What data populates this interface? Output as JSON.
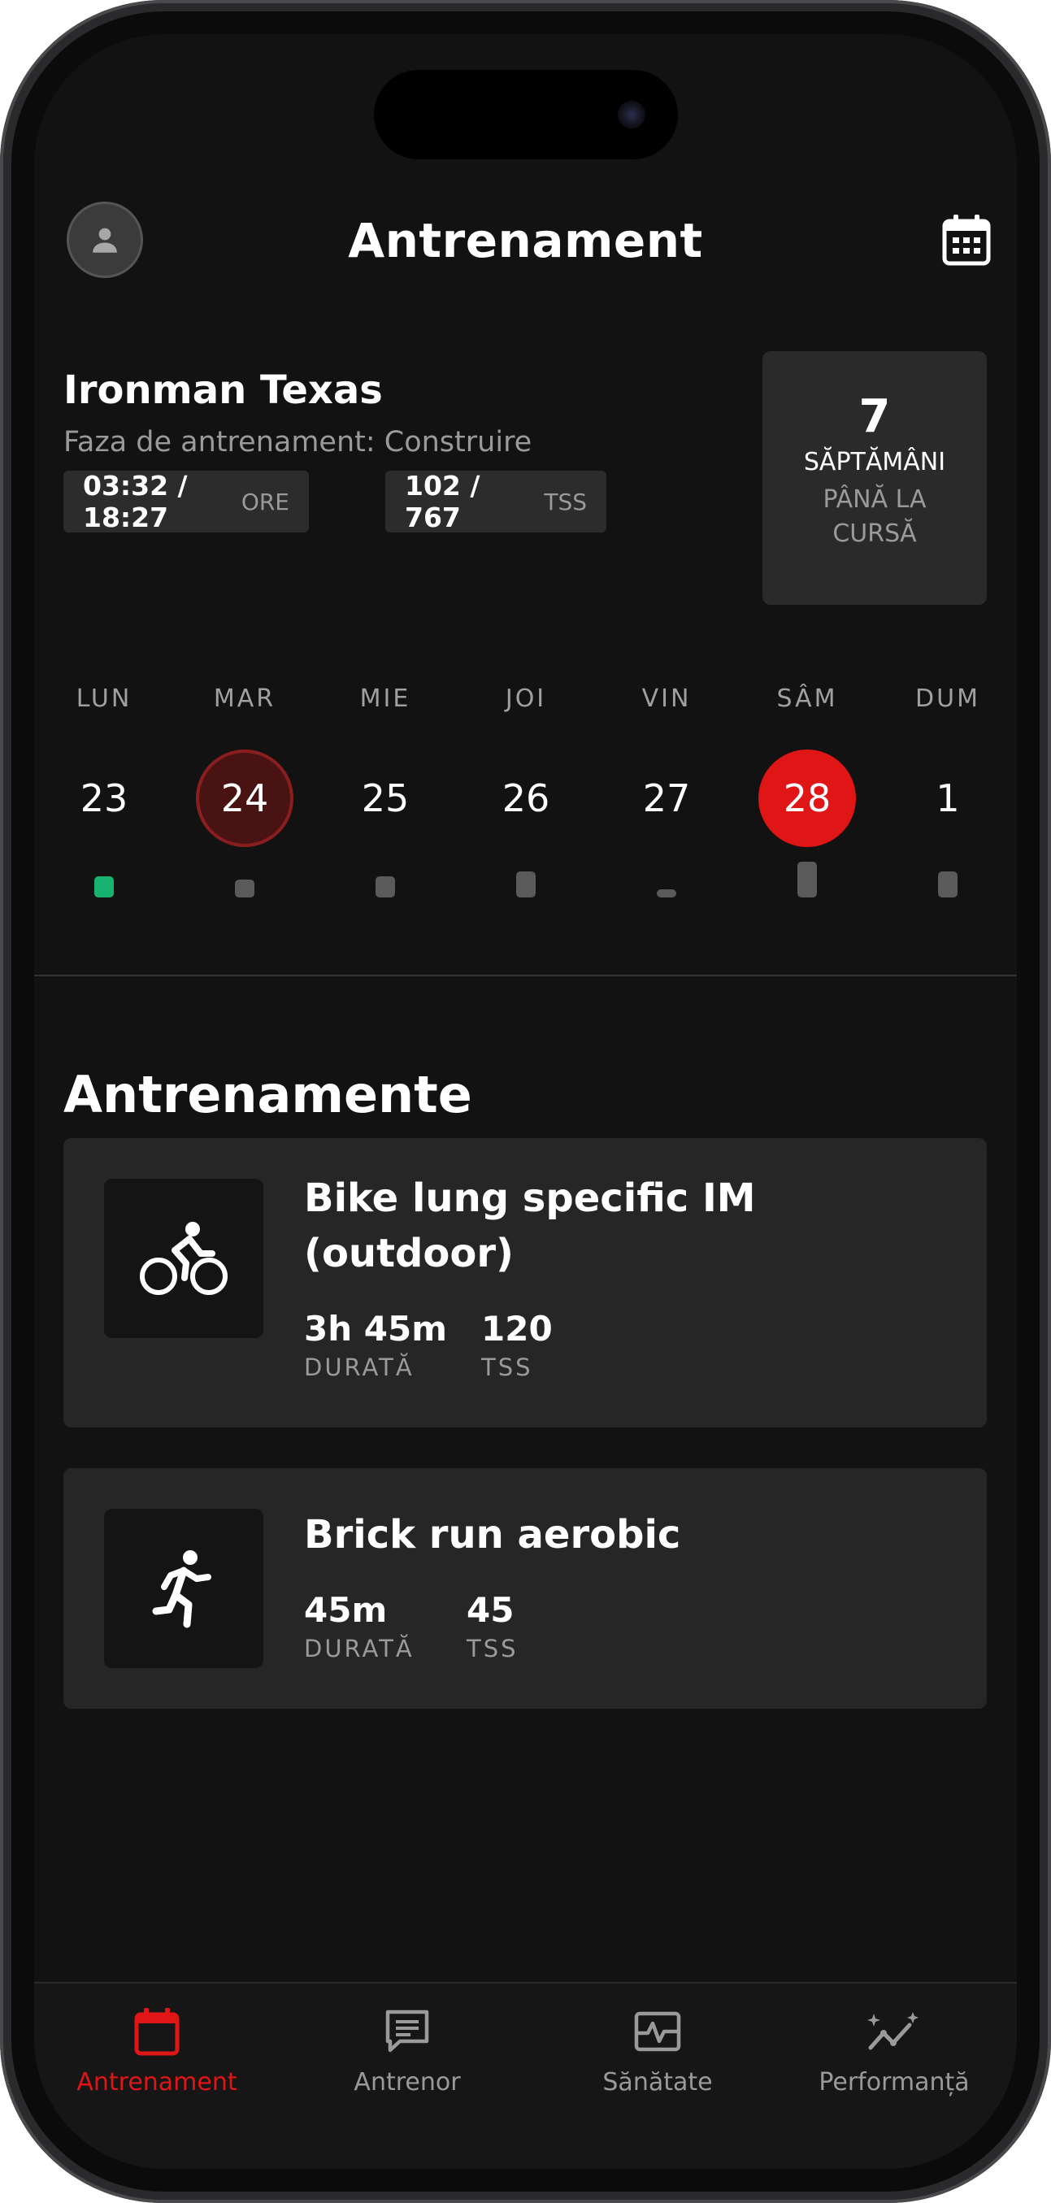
{
  "header": {
    "title": "Antrenament"
  },
  "race": {
    "name": "Ironman Texas",
    "phase": "Faza de antrenament: Construire",
    "hours_value": "03:32 / 18:27",
    "hours_unit": "ORE",
    "tss_value": "102 / 767",
    "tss_unit": "TSS",
    "weeks_number": "7",
    "weeks_unit": "SĂPTĂMÂNI",
    "weeks_sub1": "PÂNĂ LA",
    "weeks_sub2": "CURSĂ"
  },
  "week": {
    "days": [
      {
        "label": "LUN",
        "num": "23"
      },
      {
        "label": "MAR",
        "num": "24"
      },
      {
        "label": "MIE",
        "num": "25"
      },
      {
        "label": "JOI",
        "num": "26"
      },
      {
        "label": "VIN",
        "num": "27"
      },
      {
        "label": "SÂM",
        "num": "28"
      },
      {
        "label": "DUM",
        "num": "1"
      }
    ],
    "selected_day": "24",
    "today": "28"
  },
  "workouts": {
    "section_title": "Antrenamente",
    "items": [
      {
        "icon": "bike-icon",
        "title": "Bike lung specific IM (outdoor)",
        "duration": "3h 45m",
        "duration_label": "DURATĂ",
        "tss": "120",
        "tss_label": "TSS"
      },
      {
        "icon": "run-icon",
        "title": "Brick run aerobic",
        "duration": "45m",
        "duration_label": "DURATĂ",
        "tss": "45",
        "tss_label": "TSS"
      }
    ]
  },
  "tabs": [
    {
      "label": "Antrenament",
      "icon": "calendar-icon",
      "active": true
    },
    {
      "label": "Antrenor",
      "icon": "chat-icon",
      "active": false
    },
    {
      "label": "Sănătate",
      "icon": "health-icon",
      "active": false
    },
    {
      "label": "Performanță",
      "icon": "trend-icon",
      "active": false
    }
  ],
  "colors": {
    "accent": "#e01515",
    "background": "#121212",
    "card": "#262626",
    "done": "#18b26f"
  }
}
